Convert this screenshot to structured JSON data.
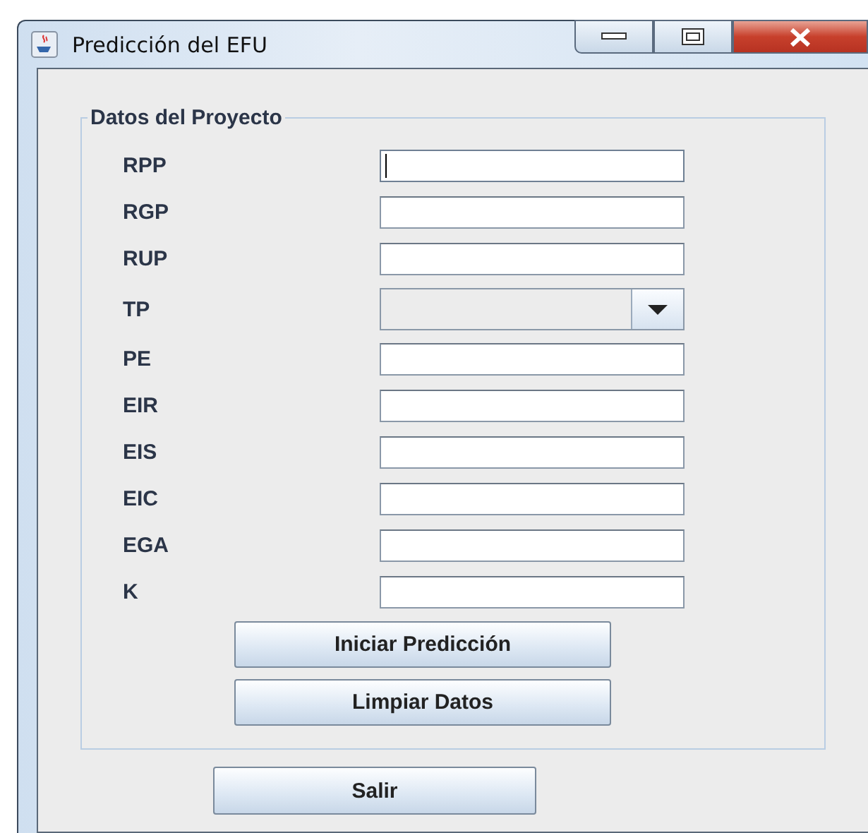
{
  "window": {
    "title": "Predicción del EFU"
  },
  "group": {
    "title": "Datos del Proyecto",
    "fields": [
      {
        "label": "RPP",
        "kind": "text",
        "focused": true
      },
      {
        "label": "RGP",
        "kind": "text",
        "focused": false
      },
      {
        "label": "RUP",
        "kind": "text",
        "focused": false
      },
      {
        "label": "TP",
        "kind": "combo",
        "focused": false
      },
      {
        "label": "PE",
        "kind": "text",
        "focused": false
      },
      {
        "label": "EIR",
        "kind": "text",
        "focused": false
      },
      {
        "label": "EIS",
        "kind": "text",
        "focused": false
      },
      {
        "label": "EIC",
        "kind": "text",
        "focused": false
      },
      {
        "label": "EGA",
        "kind": "text",
        "focused": false
      },
      {
        "label": "K",
        "kind": "text",
        "focused": false
      }
    ],
    "buttons": [
      "Iniciar Predicción",
      "Limpiar Datos"
    ]
  },
  "exit_button": "Salir"
}
